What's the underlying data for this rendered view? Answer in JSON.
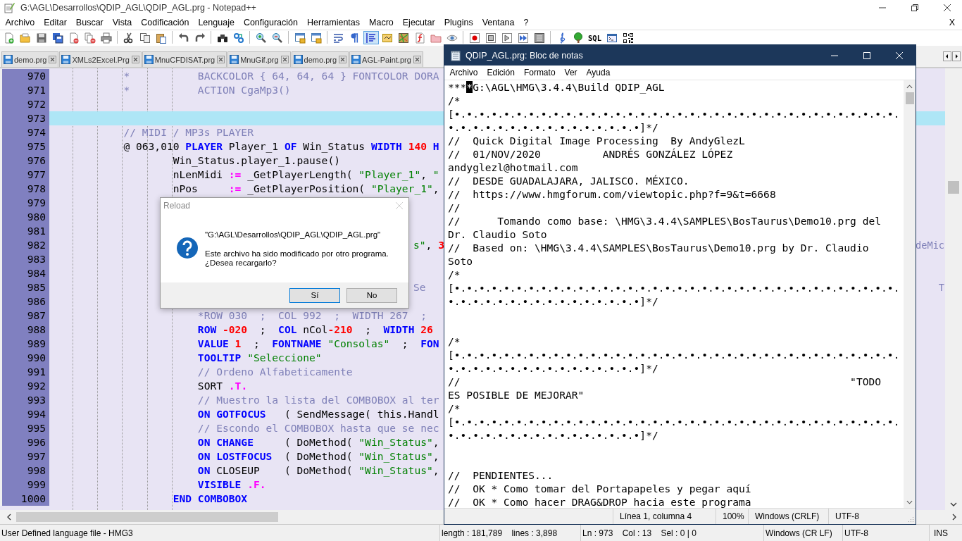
{
  "window": {
    "title": "G:\\AGL\\Desarrollos\\QDIP_AGL\\QDIP_AGL.prg - Notepad++"
  },
  "menu": [
    "Archivo",
    "Editar",
    "Buscar",
    "Vista",
    "Codificación",
    "Lenguaje",
    "Configuración",
    "Herramientas",
    "Macro",
    "Ejecutar",
    "Plugins",
    "Ventana",
    "?"
  ],
  "menu_close": "X",
  "toolbar": [
    {
      "kind": "new",
      "pressed": false
    },
    {
      "kind": "open",
      "pressed": false
    },
    {
      "kind": "save",
      "pressed": false
    },
    {
      "kind": "save_all",
      "pressed": false
    },
    {
      "kind": "close",
      "pressed": false
    },
    {
      "kind": "close_all",
      "pressed": false
    },
    {
      "kind": "print",
      "pressed": false
    },
    {
      "kind": "sep"
    },
    {
      "kind": "cut",
      "pressed": false
    },
    {
      "kind": "copy",
      "pressed": false
    },
    {
      "kind": "paste",
      "pressed": false
    },
    {
      "kind": "sep"
    },
    {
      "kind": "undo",
      "pressed": false
    },
    {
      "kind": "redo",
      "pressed": false
    },
    {
      "kind": "sep"
    },
    {
      "kind": "find",
      "pressed": false
    },
    {
      "kind": "replace",
      "pressed": false
    },
    {
      "kind": "sep"
    },
    {
      "kind": "zoom_in",
      "pressed": false
    },
    {
      "kind": "zoom_out",
      "pressed": false
    },
    {
      "kind": "sep"
    },
    {
      "kind": "sync_v",
      "pressed": false
    },
    {
      "kind": "sync_h",
      "pressed": false
    },
    {
      "kind": "sep"
    },
    {
      "kind": "wrap",
      "pressed": false
    },
    {
      "kind": "pilcrow",
      "pressed": false
    },
    {
      "kind": "indent_guide",
      "pressed": true
    },
    {
      "kind": "doc_map",
      "pressed": false
    },
    {
      "kind": "map",
      "pressed": false
    },
    {
      "kind": "function_list",
      "pressed": false
    },
    {
      "kind": "folder",
      "pressed": false
    },
    {
      "kind": "eye",
      "pressed": false
    },
    {
      "kind": "sep"
    },
    {
      "kind": "record",
      "pressed": false
    },
    {
      "kind": "stop",
      "pressed": false
    },
    {
      "kind": "play",
      "pressed": false
    },
    {
      "kind": "play_multi",
      "pressed": false
    },
    {
      "kind": "save_macro",
      "pressed": false
    },
    {
      "kind": "sep"
    },
    {
      "kind": "clef",
      "pressed": false
    },
    {
      "kind": "tree",
      "pressed": false
    },
    {
      "kind": "text",
      "label": "SQL",
      "pressed": false
    },
    {
      "kind": "console",
      "pressed": false
    },
    {
      "kind": "qr",
      "pressed": false
    }
  ],
  "tabs": [
    {
      "label": "demo.prg",
      "selected": false
    },
    {
      "label": "XMLs2Excel.Prg",
      "selected": false
    },
    {
      "label": "MnuCFDISAT.prg",
      "selected": false
    },
    {
      "label": "MnuGif.prg",
      "selected": false
    },
    {
      "label": "demo.prg",
      "selected": false
    },
    {
      "label": "AGL-Paint.prg",
      "selected": false
    }
  ],
  "editor": {
    "lines": [
      {
        "number": "970",
        "current": false,
        "kind": "code",
        "segments": [
          {
            "kind": "comment",
            "text": "            *           BACKCOLOR { 64, 64, 64 } FONTCOLOR DORA"
          }
        ]
      },
      {
        "number": "971",
        "current": false,
        "kind": "code",
        "segments": [
          {
            "kind": "comment",
            "text": "            *           ACTION CgaMp3()"
          }
        ]
      },
      {
        "number": "972",
        "current": false
      },
      {
        "number": "973",
        "current": true
      },
      {
        "number": "974",
        "current": false,
        "kind": "code",
        "segments": [
          {
            "kind": "comment",
            "text": "            // MIDI / MP3s PLAYER"
          }
        ]
      },
      {
        "number": "975",
        "current": false,
        "kind": "code",
        "segments": [
          {
            "kind": "plain",
            "text": "            @ 063,010 "
          },
          {
            "kind": "keyword",
            "text": "PLAYER"
          },
          {
            "kind": "plain",
            "text": " Player_1 "
          },
          {
            "kind": "keyword",
            "text": "OF"
          },
          {
            "kind": "plain",
            "text": " Win_Status "
          },
          {
            "kind": "keyword",
            "text": "WIDTH "
          },
          {
            "kind": "number",
            "text": "140 "
          },
          {
            "kind": "keyword",
            "text": "H"
          }
        ]
      },
      {
        "number": "976",
        "current": false,
        "kind": "code",
        "segments": [
          {
            "kind": "plain",
            "text": "                    Win_Status.player_1.pause()"
          }
        ]
      },
      {
        "number": "977",
        "current": false,
        "kind": "code",
        "segments": [
          {
            "kind": "plain",
            "text": "                    nLenMidi "
          },
          {
            "kind": "operator",
            "text": ":="
          },
          {
            "kind": "plain",
            "text": " _GetPlayerLength( "
          },
          {
            "kind": "string",
            "text": "\"Player_1\""
          },
          {
            "kind": "plain",
            "text": ", "
          },
          {
            "kind": "string",
            "text": "\""
          }
        ]
      },
      {
        "number": "978",
        "current": false,
        "kind": "code",
        "segments": [
          {
            "kind": "plain",
            "text": "                    nPos     "
          },
          {
            "kind": "operator",
            "text": ":="
          },
          {
            "kind": "plain",
            "text": " _GetPlayerPosition( "
          },
          {
            "kind": "string",
            "text": "\"Player_1\""
          },
          {
            "kind": "plain",
            "text": ","
          }
        ]
      },
      {
        "number": "979",
        "current": false
      },
      {
        "number": "980",
        "current": false
      },
      {
        "number": "981",
        "current": false
      },
      {
        "number": "982",
        "current": false,
        "kind": "partial",
        "segments": [
          {
            "kind": "string",
            "text": "s\""
          },
          {
            "kind": "plain",
            "text": ", "
          },
          {
            "kind": "number",
            "text": "3"
          }
        ],
        "tail": "deMic"
      },
      {
        "number": "983",
        "current": false
      },
      {
        "number": "984",
        "current": false
      },
      {
        "number": "985",
        "current": false,
        "kind": "partial",
        "segments": [
          {
            "kind": "comment",
            "text": "Se"
          }
        ],
        "tail": "T"
      },
      {
        "number": "986",
        "current": false
      },
      {
        "number": "987",
        "current": false,
        "kind": "code",
        "segments": [
          {
            "kind": "comment",
            "text": "                        *ROW 030  ;  COL 992  ;  WIDTH 267  ;"
          }
        ]
      },
      {
        "number": "988",
        "current": false,
        "kind": "code",
        "segments": [
          {
            "kind": "keyword",
            "text": "                        ROW "
          },
          {
            "kind": "number",
            "text": "-020"
          },
          {
            "kind": "plain",
            "text": "  ;  "
          },
          {
            "kind": "keyword",
            "text": "COL"
          },
          {
            "kind": "plain",
            "text": " nCol"
          },
          {
            "kind": "number",
            "text": "-210"
          },
          {
            "kind": "plain",
            "text": "  ;  "
          },
          {
            "kind": "keyword",
            "text": "WIDTH "
          },
          {
            "kind": "number",
            "text": "26"
          }
        ]
      },
      {
        "number": "989",
        "current": false,
        "kind": "code",
        "segments": [
          {
            "kind": "keyword",
            "text": "                        VALUE "
          },
          {
            "kind": "number",
            "text": "1"
          },
          {
            "kind": "plain",
            "text": "  ;  "
          },
          {
            "kind": "keyword",
            "text": "FONTNAME "
          },
          {
            "kind": "string",
            "text": "\"Consolas\""
          },
          {
            "kind": "plain",
            "text": "  ;  "
          },
          {
            "kind": "keyword",
            "text": "FON"
          }
        ]
      },
      {
        "number": "990",
        "current": false,
        "kind": "code",
        "segments": [
          {
            "kind": "keyword",
            "text": "                        TOOLTIP "
          },
          {
            "kind": "string",
            "text": "\"Seleccione\""
          }
        ]
      },
      {
        "number": "991",
        "current": false,
        "kind": "code",
        "segments": [
          {
            "kind": "comment",
            "text": "                        // Ordeno Alfabeticamente"
          }
        ]
      },
      {
        "number": "992",
        "current": false,
        "kind": "code",
        "segments": [
          {
            "kind": "plain",
            "text": "                        SORT "
          },
          {
            "kind": "operator",
            "text": ".T."
          }
        ]
      },
      {
        "number": "993",
        "current": false,
        "kind": "code",
        "segments": [
          {
            "kind": "comment",
            "text": "                        // Muestro la lista del COMBOBOX al ter"
          }
        ]
      },
      {
        "number": "994",
        "current": false,
        "kind": "code",
        "segments": [
          {
            "kind": "keyword",
            "text": "                        ON GOTFOCUS"
          },
          {
            "kind": "plain",
            "text": "   ( SendMessage( this.Handl"
          }
        ]
      },
      {
        "number": "995",
        "current": false,
        "kind": "code",
        "segments": [
          {
            "kind": "comment",
            "text": "                        // Escondo el COMBOBOX hasta que se nec"
          }
        ]
      },
      {
        "number": "996",
        "current": false,
        "kind": "code",
        "segments": [
          {
            "kind": "keyword",
            "text": "                        ON CHANGE"
          },
          {
            "kind": "plain",
            "text": "     ( DoMethod( "
          },
          {
            "kind": "string",
            "text": "\"Win_Status\""
          },
          {
            "kind": "plain",
            "text": ","
          }
        ]
      },
      {
        "number": "997",
        "current": false,
        "kind": "code",
        "segments": [
          {
            "kind": "keyword",
            "text": "                        ON LOSTFOCUS"
          },
          {
            "kind": "plain",
            "text": "  ( DoMethod( "
          },
          {
            "kind": "string",
            "text": "\"Win_Status\""
          },
          {
            "kind": "plain",
            "text": ","
          }
        ]
      },
      {
        "number": "998",
        "current": false,
        "kind": "code",
        "segments": [
          {
            "kind": "keyword",
            "text": "                        ON"
          },
          {
            "kind": "plain",
            "text": " CLOSEUP    ( DoMethod( "
          },
          {
            "kind": "string",
            "text": "\"Win_Status\""
          },
          {
            "kind": "plain",
            "text": ","
          }
        ]
      },
      {
        "number": "999",
        "current": false,
        "kind": "code",
        "segments": [
          {
            "kind": "keyword",
            "text": "                        VISIBLE "
          },
          {
            "kind": "operator",
            "text": ".F."
          }
        ]
      },
      {
        "number": "1000",
        "current": false,
        "kind": "code",
        "segments": [
          {
            "kind": "keyword",
            "text": "                    END COMBOBOX"
          }
        ]
      }
    ]
  },
  "status_bar": [
    "User Defined language file - HMG3",
    "length : 181,789    lines : 3,898",
    "Ln : 973    Col : 13    Sel : 0 | 0",
    "Windows (CR LF)",
    "UTF-8",
    "INS"
  ],
  "dialog": {
    "title": "Reload",
    "close_disabled": true,
    "path": "\"G:\\AGL\\Desarrollos\\QDIP_AGL\\QDIP_AGL.prg\"",
    "message": [
      "Este archivo ha sido modificado por otro programa.",
      "¿Desea recargarlo?"
    ],
    "buttons": [
      "Sí",
      "No"
    ]
  },
  "notepad": {
    "title": "QDIP_AGL.prg: Bloc de notas",
    "menu": [
      "Archivo",
      "Edición",
      "Formato",
      "Ver",
      "Ayuda"
    ],
    "lines": [
      {
        "kind": "parts",
        "parts": [
          {
            "text": "***",
            "selected": false
          },
          {
            "text": "*",
            "selected": true
          },
          {
            "text": "G:\\AGL\\HMG\\3.4.4\\Build QDIP_AGL",
            "selected": false
          }
        ]
      },
      {
        "kind": "text",
        "text": "/*"
      },
      {
        "kind": "text",
        "text": "[•.•.•.•.•.•.•.•.•.•.•.•.•.•.•.•.•.•.•.•.•.•.•.•.•.•.•.•.•.•.•.•.•.•.•.•."
      },
      {
        "kind": "text",
        "text": "•.•.•.•.•.•.•.•.•.•.•.•.•.•.•.•]*/"
      },
      {
        "kind": "text",
        "text": "//  Quick Digital Image Processing  By AndyGlezL"
      },
      {
        "kind": "text",
        "text": "//  01/NOV/2020          ANDRÉS GONZÁLEZ LÓPEZ"
      },
      {
        "kind": "text",
        "text": "andyglezl@hotmail.com"
      },
      {
        "kind": "text",
        "text": "//  DESDE GUADALAJARA, JALISCO. MÉXICO."
      },
      {
        "kind": "text",
        "text": "//  https://www.hmgforum.com/viewtopic.php?f=9&t=6668"
      },
      {
        "kind": "text",
        "text": "//"
      },
      {
        "kind": "text",
        "text": "//      Tomando como base: \\HMG\\3.4.4\\SAMPLES\\BosTaurus\\Demo10.prg del"
      },
      {
        "kind": "text",
        "text": "Dr. Claudio Soto"
      },
      {
        "kind": "text",
        "text": "//  Based on: \\HMG\\3.4.4\\SAMPLES\\BosTaurus\\Demo10.prg by Dr. Claudio"
      },
      {
        "kind": "text",
        "text": "Soto"
      },
      {
        "kind": "text",
        "text": "/*"
      },
      {
        "kind": "text",
        "text": "[•.•.•.•.•.•.•.•.•.•.•.•.•.•.•.•.•.•.•.•.•.•.•.•.•.•.•.•.•.•.•.•.•.•.•.•."
      },
      {
        "kind": "text",
        "text": "•.•.•.•.•.•.•.•.•.•.•.•.•.•.•.•]*/"
      },
      {
        "kind": "blank"
      },
      {
        "kind": "blank"
      },
      {
        "kind": "text",
        "text": "/*"
      },
      {
        "kind": "text",
        "text": "[•.•.•.•.•.•.•.•.•.•.•.•.•.•.•.•.•.•.•.•.•.•.•.•.•.•.•.•.•.•.•.•.•.•.•.•."
      },
      {
        "kind": "text",
        "text": "•.•.•.•.•.•.•.•.•.•.•.•.•.•.•.•]*/"
      },
      {
        "kind": "text",
        "text": "//                                                               \"TODO"
      },
      {
        "kind": "text",
        "text": "ES POSIBLE DE MEJORAR\""
      },
      {
        "kind": "text",
        "text": "/*"
      },
      {
        "kind": "text",
        "text": "[•.•.•.•.•.•.•.•.•.•.•.•.•.•.•.•.•.•.•.•.•.•.•.•.•.•.•.•.•.•.•.•.•.•.•.•."
      },
      {
        "kind": "text",
        "text": "•.•.•.•.•.•.•.•.•.•.•.•.•.•.•.•]*/"
      },
      {
        "kind": "blank"
      },
      {
        "kind": "blank"
      },
      {
        "kind": "text",
        "text": "//  PENDIENTES..."
      },
      {
        "kind": "text",
        "text": "//  OK * Como tomar del Portapapeles y pegar aquí"
      },
      {
        "kind": "text",
        "text": "//  OK * Como hacer DRAG&DROP hacia este programa"
      }
    ],
    "status_bar": [
      "Línea 1, columna 4",
      "100%",
      "Windows (CRLF)",
      "UTF-8"
    ]
  }
}
